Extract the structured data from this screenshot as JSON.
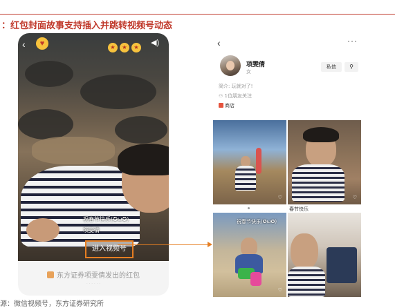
{
  "figure": {
    "title": "：红包封面故事支持插入并跳转视频号动态",
    "source": "源：微信视频号，东方证券研究所"
  },
  "cover": {
    "back_glyph": "‹",
    "kiss_glyph": "😘",
    "emojis": [
      "🤩",
      "🤩",
      "🤩"
    ],
    "sound_glyph": "🔊",
    "greeting": "祝春节快乐(✪ω✪)",
    "poster": "项雯倩",
    "enter_button": "进入视频号",
    "footer": "东方证券项雯倩发出的红包",
    "footer_sub": "· · · · · ·",
    "accent_color": "#e67e22"
  },
  "channel": {
    "back_glyph": "‹",
    "more_glyph": "···",
    "name": "项雯倩",
    "gender": "女",
    "message_button": "私信",
    "follow_glyph": "♂",
    "bio": "简介: 玩就对了!",
    "friends": "1位朋友关注",
    "shop": "商店",
    "videos": [
      {
        "caption": "",
        "likes": "♡"
      },
      {
        "caption": "春节快乐",
        "likes": "♡"
      },
      {
        "caption": "",
        "overlay": "祝春节快乐(✪ω✪)",
        "likes": "♡"
      },
      {
        "caption": "",
        "likes": ""
      }
    ]
  }
}
